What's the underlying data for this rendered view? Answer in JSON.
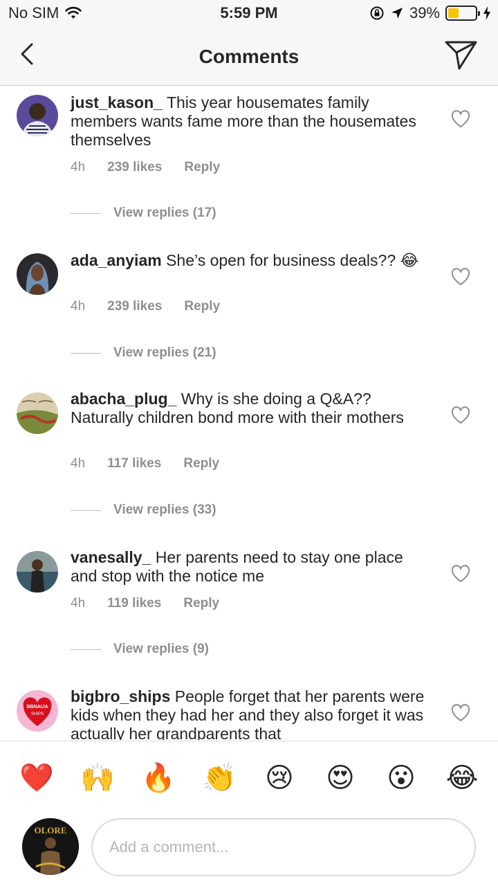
{
  "status_bar": {
    "carrier": "No SIM",
    "time": "5:59 PM",
    "battery": "39%",
    "battery_level": 0.39
  },
  "header": {
    "title": "Comments"
  },
  "comments": [
    {
      "username": "just_kason_",
      "text": "This year housemates family members wants fame more than the housemates themselves",
      "time": "4h",
      "likes": "239 likes",
      "reply": "Reply",
      "view_replies": "View replies (17)"
    },
    {
      "username": "ada_anyiam",
      "text": "She’s open for business deals?? 😂",
      "time": "4h",
      "likes": "239 likes",
      "reply": "Reply",
      "view_replies": "View replies (21)"
    },
    {
      "username": "abacha_plug_",
      "text": "Why is she doing a Q&A?? Naturally children bond more with their mothers",
      "time": "4h",
      "likes": "117 likes",
      "reply": "Reply",
      "view_replies": "View replies (33)"
    },
    {
      "username": "vanesally_",
      "text": "Her parents need to stay one place and stop with the notice me",
      "time": "4h",
      "likes": "119 likes",
      "reply": "Reply",
      "view_replies": "View replies (9)"
    },
    {
      "username": "bigbro_ships",
      "text": "People forget that her parents were kids when they had her and they also forget it was actually her grandparents that"
    }
  ],
  "avatar_labels": {
    "bigbro_ships": [
      "BBNAIJA",
      "SHIPS"
    ],
    "my_avatar": "OLORE"
  },
  "emoji_bar": [
    "❤️",
    "🙌",
    "🔥",
    "👏",
    "😢",
    "😍",
    "😮",
    "😂"
  ],
  "comment_input": {
    "placeholder": "Add a comment..."
  },
  "colors": {
    "secondary_text": "#8e8e8e",
    "primary_text": "#262626",
    "battery_fill": "#f7c600"
  }
}
